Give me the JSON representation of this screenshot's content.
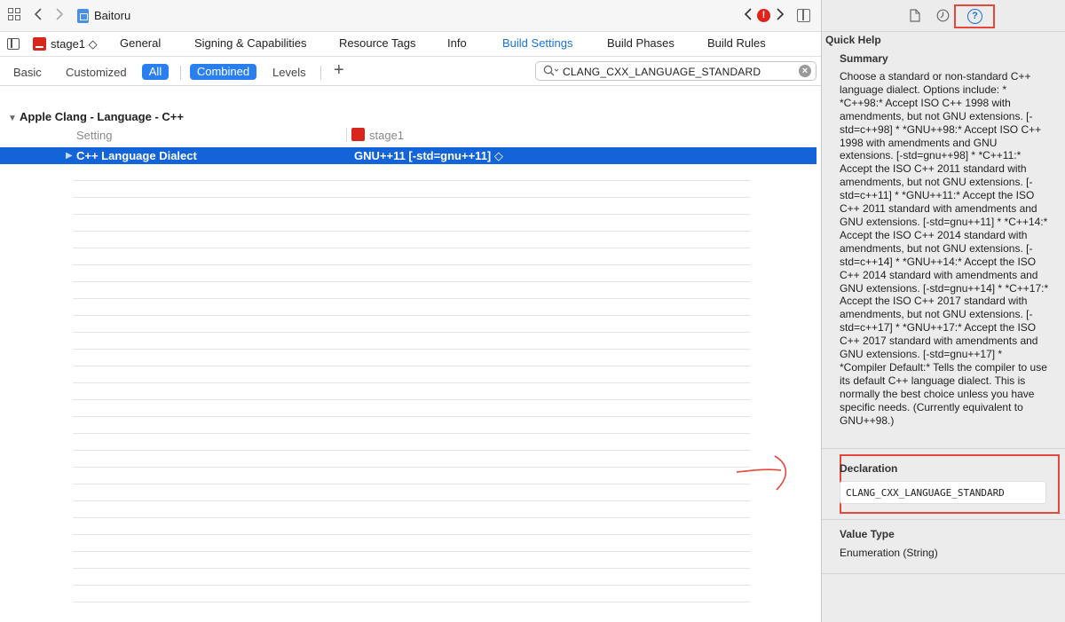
{
  "window": {
    "title": "Baitoru",
    "error_badge": "!"
  },
  "tabbar": {
    "target": "stage1 ◇",
    "tabs": [
      {
        "label": "General"
      },
      {
        "label": "Signing & Capabilities"
      },
      {
        "label": "Resource Tags"
      },
      {
        "label": "Info"
      },
      {
        "label": "Build Settings"
      },
      {
        "label": "Build Phases"
      },
      {
        "label": "Build Rules"
      }
    ]
  },
  "filter": {
    "basic": "Basic",
    "customized": "Customized",
    "all": "All",
    "combined": "Combined",
    "levels": "Levels",
    "add": "+",
    "search_value": "CLANG_CXX_LANGUAGE_STANDARD"
  },
  "settings": {
    "section": "Apple Clang - Language - C++",
    "col_setting": "Setting",
    "col_target": "stage1",
    "row": {
      "setting": "C++ Language Dialect",
      "value": "GNU++11 [-std=gnu++11] ◇"
    }
  },
  "inspector": {
    "quick_help": "Quick Help",
    "summary_title": "Summary",
    "summary": "Choose a standard or non-standard C++ language dialect. Options include: * *C++98:* Accept ISO C++ 1998 with amendments, but not GNU extensions. [-std=c++98] * *GNU++98:* Accept ISO C++ 1998 with amendments and GNU extensions. [-std=gnu++98] * *C++11:* Accept the ISO C++ 2011 standard with amendments, but not GNU extensions. [-std=c++11] * *GNU++11:* Accept the ISO C++ 2011 standard with amendments and GNU extensions. [-std=gnu++11] * *C++14:* Accept the ISO C++ 2014 standard with amendments, but not GNU extensions. [-std=c++14] * *GNU++14:* Accept the ISO C++ 2014 standard with amendments and GNU extensions. [-std=gnu++14] * *C++17:* Accept the ISO C++ 2017 standard with amendments, but not GNU extensions. [-std=c++17] * *GNU++17:* Accept the ISO C++ 2017 standard with amendments and GNU extensions. [-std=gnu++17] * *Compiler Default:* Tells the compiler to use its default C++ language dialect. This is normally the best choice unless you have specific needs. (Currently equivalent to GNU++98.)",
    "declaration_title": "Declaration",
    "declaration": "CLANG_CXX_LANGUAGE_STANDARD",
    "value_type_title": "Value Type",
    "value_type": "Enumeration (String)"
  },
  "icons": {
    "grid": "grid-icon",
    "back": "chevron-left-icon",
    "forward": "chevron-right-icon",
    "file": "file-icon",
    "history": "clock-icon",
    "help": "question-icon"
  },
  "colors": {
    "accent": "#1a73d9",
    "selection": "#1464d9",
    "highlight_box": "#e5473a",
    "target_icon": "#d9261c"
  }
}
